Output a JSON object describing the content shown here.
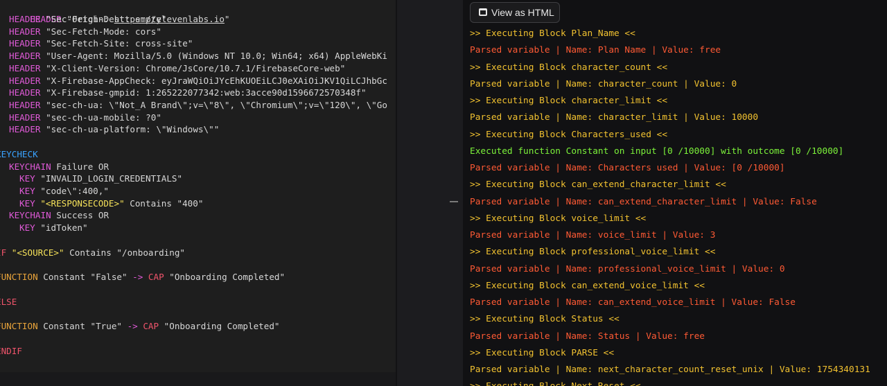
{
  "editor": {
    "headers": [
      {
        "kw": "HEADER",
        "pre": "\"Origin: ",
        "link": "https://elevenlabs.io",
        "post": "\""
      },
      {
        "kw": "HEADER",
        "text": "\"Sec-Fetch-Dest: empty\""
      },
      {
        "kw": "HEADER",
        "text": "\"Sec-Fetch-Mode: cors\""
      },
      {
        "kw": "HEADER",
        "text": "\"Sec-Fetch-Site: cross-site\""
      },
      {
        "kw": "HEADER",
        "text": "\"User-Agent: Mozilla/5.0 (Windows NT 10.0; Win64; x64) AppleWebKi"
      },
      {
        "kw": "HEADER",
        "text": "\"X-Client-Version: Chrome/JsCore/10.7.1/FirebaseCore-web\""
      },
      {
        "kw": "HEADER",
        "text": "\"X-Firebase-AppCheck: eyJraWQiOiJYcEhKUOEiLCJ0eXAiOiJKV1QiLCJhbGc"
      },
      {
        "kw": "HEADER",
        "text": "\"X-Firebase-gmpid: 1:265222077342:web:3acce90d1596672570348f\""
      },
      {
        "kw": "HEADER",
        "text": "\"sec-ch-ua: \\\"Not_A Brand\\\";v=\\\"8\\\", \\\"Chromium\\\";v=\\\"120\\\", \\\"Go"
      },
      {
        "kw": "HEADER",
        "text": "\"sec-ch-ua-mobile: ?0\""
      },
      {
        "kw": "HEADER",
        "text": "\"sec-ch-ua-platform: \\\"Windows\\\"\""
      }
    ],
    "keycheck": "KEYCHECK",
    "keychain_kw": "KEYCHAIN",
    "key_kw": "KEY",
    "chain1_text": "Failure OR",
    "key1": "\"INVALID_LOGIN_CREDENTIALS\"",
    "key2": "\"code\\\":400,\"",
    "key3_tag": "\"<RESPONSECODE>\"",
    "key3_rest": " Contains \"400\"",
    "chain2_text": "Success OR",
    "key4": "\"idToken\"",
    "if_kw": "IF",
    "if_tag": "\"<SOURCE>\"",
    "if_rest": " Contains \"/onboarding\"",
    "function_kw": "FUNCTION",
    "fn1_text": " Constant \"False\" ",
    "arrow": "->",
    "cap_kw": "CAP",
    "cap_text": " \"Onboarding Completed\"",
    "else_kw": "ELSE",
    "fn2_text": " Constant \"True\" ",
    "endif_kw": "ENDIF"
  },
  "log_panel": {
    "button_label": "View as HTML",
    "lines": [
      {
        "style": "exec",
        "text": ">> Executing Block Plan_Name <<"
      },
      {
        "style": "parsed-red",
        "text": "Parsed variable | Name: Plan Name | Value: free"
      },
      {
        "style": "exec",
        "text": ">> Executing Block character_count <<"
      },
      {
        "style": "parsed-yel",
        "text": "Parsed variable | Name: character_count | Value: 0"
      },
      {
        "style": "exec",
        "text": ">> Executing Block character_limit <<"
      },
      {
        "style": "parsed-yel",
        "text": "Parsed variable | Name: character_limit | Value: 10000"
      },
      {
        "style": "exec",
        "text": ">> Executing Block Characters_used <<"
      },
      {
        "style": "func",
        "text": "Executed function Constant on input [0 /10000] with outcome [0 /10000]"
      },
      {
        "style": "parsed-red",
        "text": "Parsed variable | Name: Characters used | Value: [0 /10000]"
      },
      {
        "style": "exec",
        "text": ">> Executing Block can_extend_character_limit <<"
      },
      {
        "style": "parsed-red",
        "text": "Parsed variable | Name: can_extend_character_limit | Value: False"
      },
      {
        "style": "exec",
        "text": ">> Executing Block voice_limit <<"
      },
      {
        "style": "parsed-red",
        "text": "Parsed variable | Name: voice_limit | Value: 3"
      },
      {
        "style": "exec",
        "text": ">> Executing Block professional_voice_limit <<"
      },
      {
        "style": "parsed-red",
        "text": "Parsed variable | Name: professional_voice_limit | Value: 0"
      },
      {
        "style": "exec",
        "text": ">> Executing Block can_extend_voice_limit <<"
      },
      {
        "style": "parsed-red",
        "text": "Parsed variable | Name: can_extend_voice_limit | Value: False"
      },
      {
        "style": "exec",
        "text": ">> Executing Block Status <<"
      },
      {
        "style": "parsed-red",
        "text": "Parsed variable | Name: Status | Value: free"
      },
      {
        "style": "exec",
        "text": ">> Executing Block PARSE <<"
      },
      {
        "style": "parsed-yel",
        "text": "Parsed variable | Name: next_character_count_reset_unix | Value: 1754340131"
      },
      {
        "style": "exec",
        "text": ">> Executing Block Next Reset <<"
      }
    ]
  },
  "colors": {
    "exec": "#f2c230",
    "parsed_red": "#ff5a34",
    "parsed_yellow": "#f2c230",
    "function": "#7cf23a",
    "header_keyword": "#e05ad8",
    "function_keyword": "#e8a33a",
    "cap_keyword": "#f0546b",
    "keycheck_keyword": "#3aa3ff"
  }
}
